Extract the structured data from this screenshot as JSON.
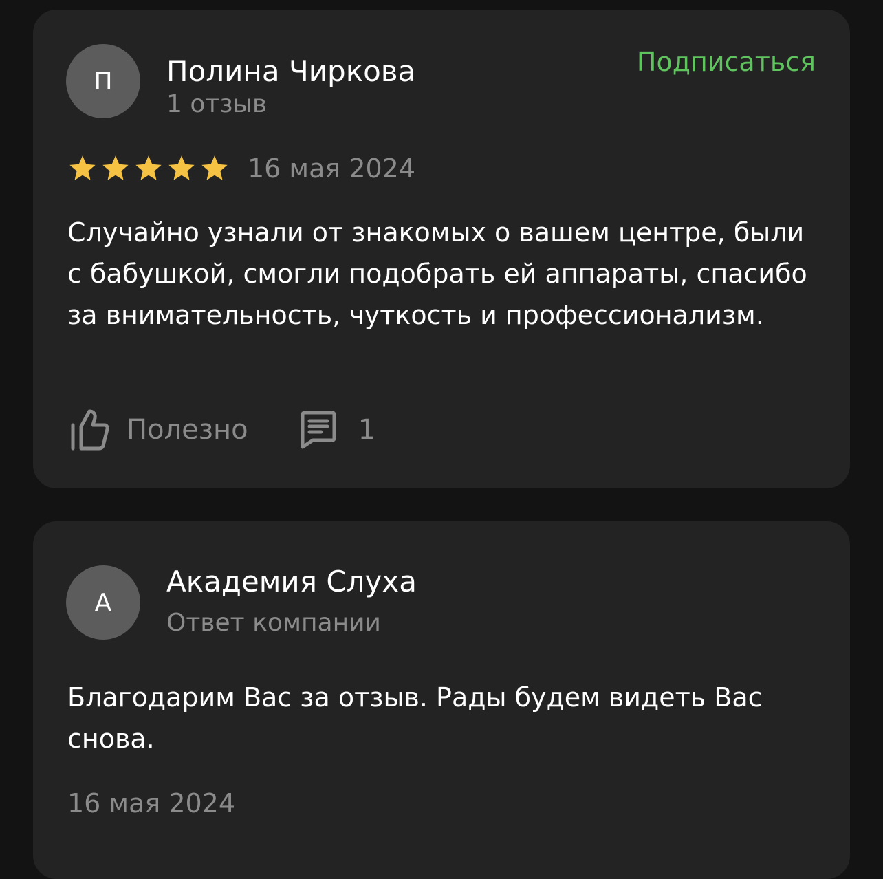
{
  "review": {
    "author": {
      "initial": "П",
      "name": "Полина Чиркова",
      "reviews_count": "1 отзыв"
    },
    "subscribe_label": "Подписаться",
    "rating": 5,
    "rating_max": 5,
    "date": "16 мая 2024",
    "text": "Случайно узнали от знакомых о вашем центре, были с бабушкой, смогли подобрать ей аппараты, спасибо за внимательность, чуткость и профессионализм.",
    "useful_label": "Полезно",
    "comments_count": "1"
  },
  "reply": {
    "author": {
      "initial": "А",
      "name": "Академия Слуха",
      "role": "Ответ компании"
    },
    "text": "Благодарим Вас за отзыв. Рады будем видеть Вас снова.",
    "date": "16 мая 2024"
  },
  "colors": {
    "page_background": "#131313",
    "card_background": "#232323",
    "avatar_background": "#5c5c5c",
    "accent_green": "#5fc45e",
    "star_yellow": "#f5c244",
    "secondary_text": "#8b8b8b",
    "primary_text": "#ffffff"
  },
  "icons": {
    "star": "star-icon",
    "useful": "thumbs-up-icon",
    "comments": "comment-icon"
  }
}
